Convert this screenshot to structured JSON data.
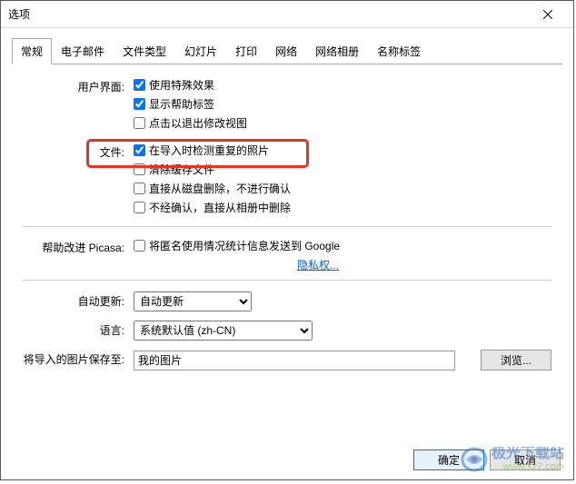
{
  "window": {
    "title": "选项"
  },
  "tabs": [
    "常规",
    "电子邮件",
    "文件类型",
    "幻灯片",
    "打印",
    "网络",
    "网络相册",
    "名称标签"
  ],
  "active_tab": 0,
  "labels": {
    "ui": "用户界面:",
    "file": "文件:",
    "improve": "帮助改进 Picasa:",
    "autoupdate": "自动更新:",
    "language": "语言:",
    "saveloc": "将导入的图片保存至:"
  },
  "checks": {
    "special_effects": "使用特殊效果",
    "help_labels": "显示帮助标签",
    "click_exit_edit": "点击以退出修改视图",
    "detect_dup": "在导入时检测重复的照片",
    "clear_cache": "清除缓存文件",
    "delete_noconfirm": "直接从磁盘删除，不进行确认",
    "album_delete_noconfirm": "不经确认，直接从相册中删除",
    "send_stats": "将匿名使用情况统计信息发送到 Google"
  },
  "privacy_link": "隐私权...",
  "autoupdate_value": "自动更新",
  "language_value": "系统默认值 (zh-CN)",
  "saveloc_value": "我的图片",
  "buttons": {
    "browse": "浏览...",
    "ok": "确定",
    "cancel": "取消"
  },
  "watermark": {
    "main": "极光下载站",
    "sub": "www.xz7.com"
  }
}
